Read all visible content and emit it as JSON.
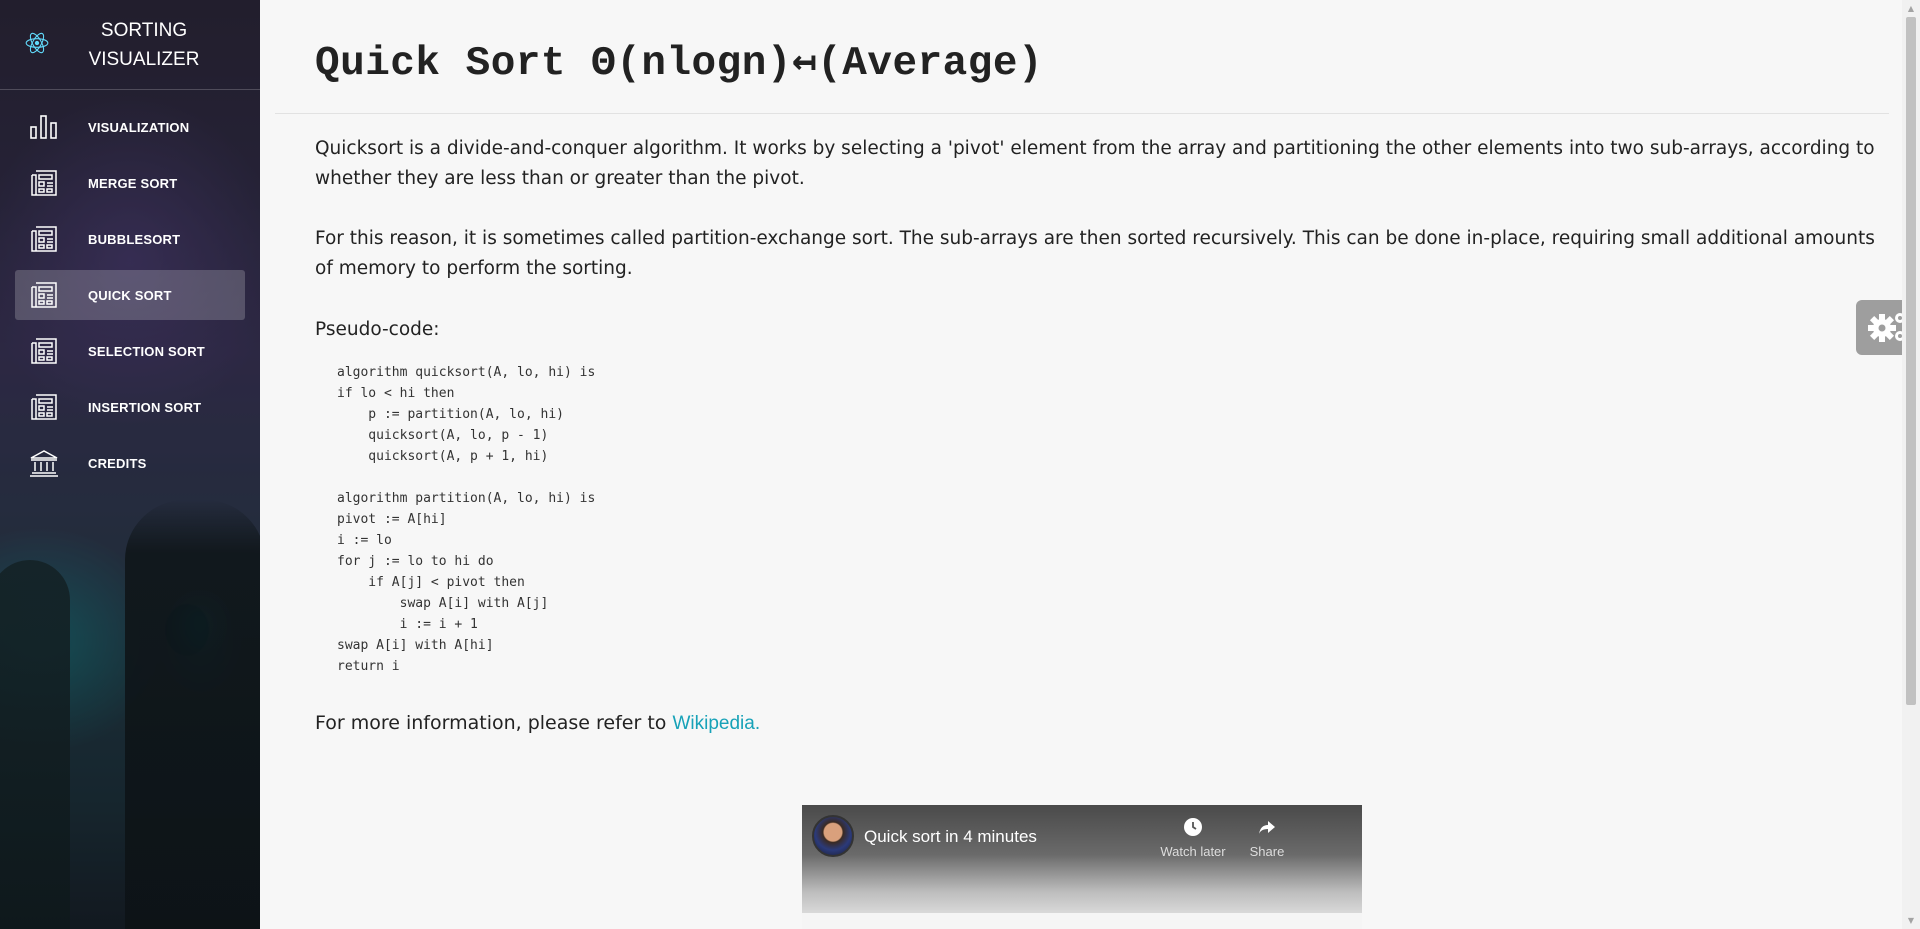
{
  "sidebar": {
    "brand": {
      "title_line1": "SORTING",
      "title_line2": "VISUALIZER",
      "icon": "react-atom-icon"
    },
    "items": [
      {
        "label": "VISUALIZATION",
        "icon": "bar-chart-icon",
        "active": false
      },
      {
        "label": "MERGE SORT",
        "icon": "document-list-icon",
        "active": false
      },
      {
        "label": "BUBBLESORT",
        "icon": "document-list-icon",
        "active": false
      },
      {
        "label": "QUICK SORT",
        "icon": "document-list-icon",
        "active": true
      },
      {
        "label": "SELECTION SORT",
        "icon": "document-list-icon",
        "active": false
      },
      {
        "label": "INSERTION SORT",
        "icon": "document-list-icon",
        "active": false
      },
      {
        "label": "CREDITS",
        "icon": "bank-building-icon",
        "active": false
      }
    ]
  },
  "main": {
    "title": "Quick Sort Θ(nlogn)↤(Average)",
    "paragraph1": "Quicksort is a divide-and-conquer algorithm. It works by selecting a 'pivot' element from the array and partitioning the other elements into two sub-arrays, according to whether they are less than or greater than the pivot.",
    "paragraph2": "For this reason, it is sometimes called partition-exchange sort. The sub-arrays are then sorted recursively. This can be done in-place, requiring small additional amounts of memory to perform the sorting.",
    "pseudo_label": "Pseudo-code:",
    "pseudo_code": "algorithm quicksort(A, lo, hi) is\nif lo < hi then\n    p := partition(A, lo, hi)\n    quicksort(A, lo, p - 1)\n    quicksort(A, p + 1, hi)\n\nalgorithm partition(A, lo, hi) is\npivot := A[hi]\ni := lo\nfor j := lo to hi do\n    if A[j] < pivot then\n        swap A[i] with A[j]\n        i := i + 1\nswap A[i] with A[hi]\nreturn i",
    "more_info_text": "For more information, please refer to ",
    "more_info_link": "Wikipedia."
  },
  "video": {
    "title": "Quick sort in 4 minutes",
    "watch_later": "Watch later",
    "share": "Share"
  },
  "colors": {
    "link": "#17a2b8",
    "react_icon": "#61dafb",
    "gear_widget_bg": "#9e9e9e"
  }
}
